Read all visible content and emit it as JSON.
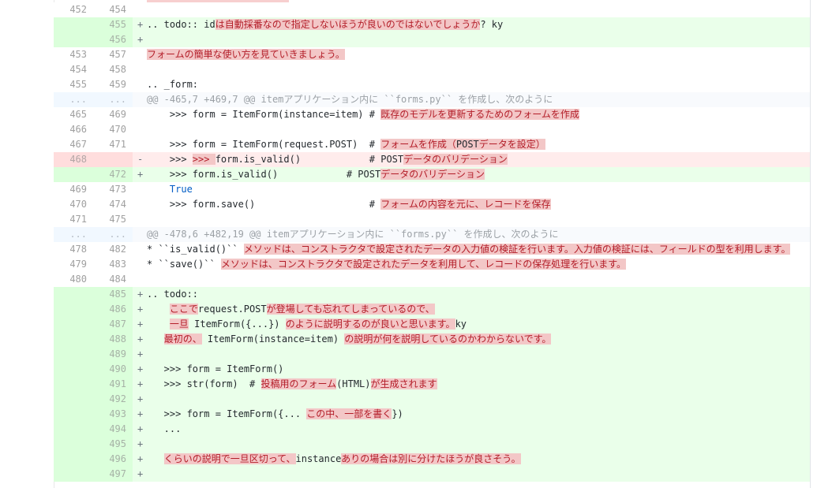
{
  "rows": [
    {
      "type": "ctx",
      "old": "452",
      "new": "454",
      "marker": "",
      "segs": []
    },
    {
      "type": "add",
      "old": "",
      "new": "455",
      "marker": "+",
      "segs": [
        {
          "t": ".. todo:: id"
        },
        {
          "t": "は自動採番なので指定しないほうが良いのではないでしょうか",
          "h": 1
        },
        {
          "t": "? ky"
        }
      ]
    },
    {
      "type": "add",
      "old": "",
      "new": "456",
      "marker": "+",
      "segs": []
    },
    {
      "type": "ctx",
      "old": "453",
      "new": "457",
      "marker": "",
      "segs": [
        {
          "t": "フォームの簡単な使い方を見ていきましょう。",
          "h": 1
        }
      ]
    },
    {
      "type": "ctx",
      "old": "454",
      "new": "458",
      "marker": "",
      "segs": []
    },
    {
      "type": "ctx",
      "old": "455",
      "new": "459",
      "marker": "",
      "segs": [
        {
          "t": ".. _form:"
        }
      ]
    },
    {
      "type": "hunk",
      "old": "...",
      "new": "...",
      "marker": "",
      "segs": [
        {
          "t": "@@ -465,7 +469,7 @@ itemアプリケーション内に ``forms.py`` を作成し、次のように"
        }
      ]
    },
    {
      "type": "ctx",
      "old": "465",
      "new": "469",
      "marker": "",
      "segs": [
        {
          "t": "    >>> form = ItemForm(instance=item) # "
        },
        {
          "t": "既存のモデルを更新するためのフォームを作成",
          "h": 1
        }
      ]
    },
    {
      "type": "ctx",
      "old": "466",
      "new": "470",
      "marker": "",
      "segs": []
    },
    {
      "type": "ctx",
      "old": "467",
      "new": "471",
      "marker": "",
      "segs": [
        {
          "t": "    >>> form = ItemForm(request.POST)  # "
        },
        {
          "t": "フォームを作成（",
          "h": 1
        },
        {
          "t": "POST",
          "h": 2
        },
        {
          "t": "データを設定）",
          "h": 1
        }
      ]
    },
    {
      "type": "del",
      "old": "468",
      "new": "",
      "marker": "-",
      "segs": [
        {
          "t": "    >>> "
        },
        {
          "t": ">>> ",
          "h": 1
        },
        {
          "t": "form.is_valid()            # POST"
        },
        {
          "t": "データのバリデーション",
          "h": 1
        }
      ]
    },
    {
      "type": "add",
      "old": "",
      "new": "472",
      "marker": "+",
      "segs": [
        {
          "t": "    >>> form.is_valid()            # POST"
        },
        {
          "t": "データのバリデーション",
          "h": 1
        }
      ]
    },
    {
      "type": "ctx",
      "old": "469",
      "new": "473",
      "marker": "",
      "segs": [
        {
          "t": "    "
        },
        {
          "t": "True",
          "k": 1
        }
      ]
    },
    {
      "type": "ctx",
      "old": "470",
      "new": "474",
      "marker": "",
      "segs": [
        {
          "t": "    >>> form.save()                    # "
        },
        {
          "t": "フォームの内容を元に、レコードを保存",
          "h": 1
        }
      ]
    },
    {
      "type": "ctx",
      "old": "471",
      "new": "475",
      "marker": "",
      "segs": []
    },
    {
      "type": "hunk",
      "old": "...",
      "new": "...",
      "marker": "",
      "segs": [
        {
          "t": "@@ -478,6 +482,19 @@ itemアプリケーション内に ``forms.py`` を作成し、次のように"
        }
      ]
    },
    {
      "type": "ctx",
      "old": "478",
      "new": "482",
      "marker": "",
      "segs": [
        {
          "t": "* ``is_valid()`` "
        },
        {
          "t": "メソッドは、コンストラクタで設定されたデータの入力値の検証を行います。入力値の検証には、フィールドの型を利用します。",
          "h": 1
        }
      ]
    },
    {
      "type": "ctx",
      "old": "479",
      "new": "483",
      "marker": "",
      "segs": [
        {
          "t": "* ``save()`` "
        },
        {
          "t": "メソッドは、コンストラクタで設定されたデータを利用して、レコードの保存処理を行います。",
          "h": 1
        }
      ]
    },
    {
      "type": "ctx",
      "old": "480",
      "new": "484",
      "marker": "",
      "segs": []
    },
    {
      "type": "add",
      "old": "",
      "new": "485",
      "marker": "+",
      "segs": [
        {
          "t": ".. todo::"
        }
      ]
    },
    {
      "type": "add",
      "old": "",
      "new": "486",
      "marker": "+",
      "segs": [
        {
          "t": "    "
        },
        {
          "t": "ここで",
          "h": 1
        },
        {
          "t": "request.POST"
        },
        {
          "t": "が登場しても忘れてしまっているので、",
          "h": 1
        }
      ]
    },
    {
      "type": "add",
      "old": "",
      "new": "487",
      "marker": "+",
      "segs": [
        {
          "t": "    "
        },
        {
          "t": "一旦",
          "h": 1
        },
        {
          "t": " ItemForm({...}) "
        },
        {
          "t": "のように説明するのが良いと思います。",
          "h": 1
        },
        {
          "t": "ky"
        }
      ]
    },
    {
      "type": "add",
      "old": "",
      "new": "488",
      "marker": "+",
      "segs": [
        {
          "t": "   "
        },
        {
          "t": "最初の、",
          "h": 1
        },
        {
          "t": " ItemForm(instance=item) "
        },
        {
          "t": "の説明が何を説明しているのかわからないです。",
          "h": 1
        }
      ]
    },
    {
      "type": "add",
      "old": "",
      "new": "489",
      "marker": "+",
      "segs": []
    },
    {
      "type": "add",
      "old": "",
      "new": "490",
      "marker": "+",
      "segs": [
        {
          "t": "   >>> form = ItemForm()"
        }
      ]
    },
    {
      "type": "add",
      "old": "",
      "new": "491",
      "marker": "+",
      "segs": [
        {
          "t": "   >>> str(form)  # "
        },
        {
          "t": "投稿用のフォーム",
          "h": 1
        },
        {
          "t": "(HTML)"
        },
        {
          "t": "が生成されます",
          "h": 1
        }
      ]
    },
    {
      "type": "add",
      "old": "",
      "new": "492",
      "marker": "+",
      "segs": []
    },
    {
      "type": "add",
      "old": "",
      "new": "493",
      "marker": "+",
      "segs": [
        {
          "t": "   >>> form = ItemForm({... "
        },
        {
          "t": "この中、一部を書く",
          "h": 1
        },
        {
          "t": "})"
        }
      ]
    },
    {
      "type": "add",
      "old": "",
      "new": "494",
      "marker": "+",
      "segs": [
        {
          "t": "   ..."
        }
      ]
    },
    {
      "type": "add",
      "old": "",
      "new": "495",
      "marker": "+",
      "segs": []
    },
    {
      "type": "add",
      "old": "",
      "new": "496",
      "marker": "+",
      "segs": [
        {
          "t": "   "
        },
        {
          "t": "くらいの説明で一旦区切って、",
          "h": 1
        },
        {
          "t": "instance"
        },
        {
          "t": "ありの場合は別に分けたほうが良さそう。",
          "h": 1
        }
      ]
    },
    {
      "type": "add",
      "old": "",
      "new": "497",
      "marker": "+",
      "segs": []
    }
  ]
}
